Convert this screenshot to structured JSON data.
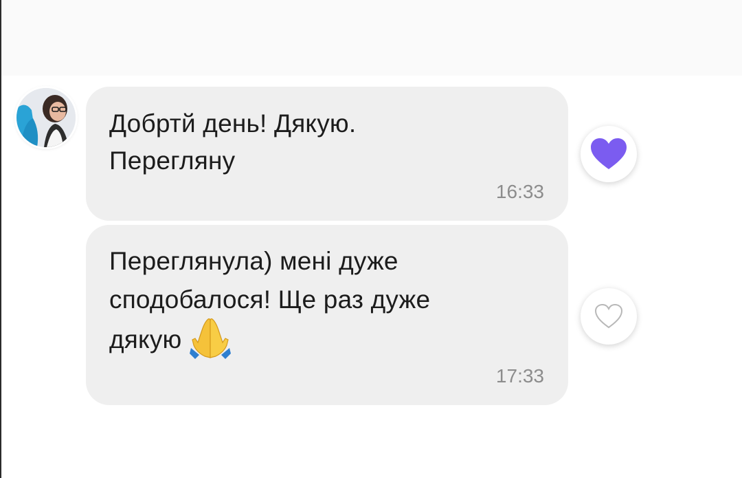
{
  "messages": [
    {
      "lines": [
        "Добртй день! Дякую.",
        "Переглянy"
      ],
      "time": "16:33",
      "reaction": "liked"
    },
    {
      "lines": [
        "Переглянула) мені дуже",
        "сподобалося! Ще раз дуже",
        "дякую"
      ],
      "emoji": "🙏",
      "time": "17:33",
      "reaction": "not-liked"
    }
  ],
  "icons": {
    "avatar": "avatar-photo",
    "reaction_liked": "heart-filled-icon",
    "reaction_empty": "heart-outline-icon",
    "emoji": "folded-hands-icon"
  },
  "colors": {
    "bubble": "#efefef",
    "heart_filled": "#7b5cf0",
    "heart_outline": "#b8b8b8",
    "timestamp": "#8c8c8c",
    "text": "#1c1c1c"
  }
}
